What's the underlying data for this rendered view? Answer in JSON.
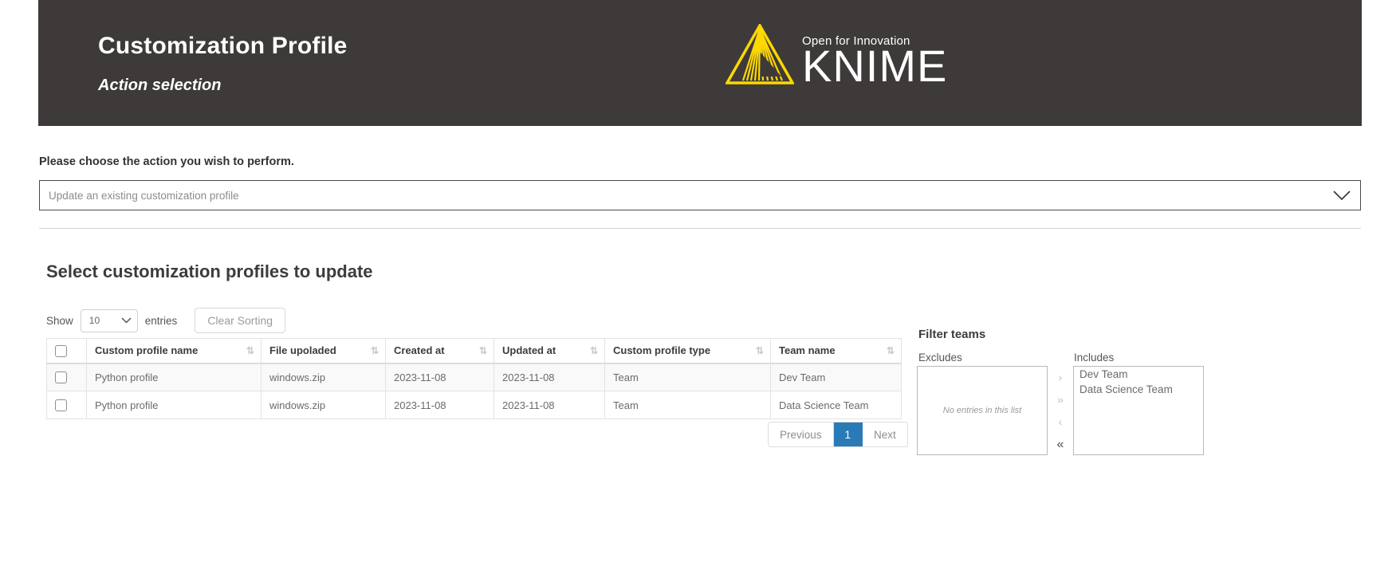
{
  "header": {
    "title": "Customization Profile",
    "subtitle": "Action selection",
    "logo_tagline": "Open for Innovation",
    "logo_word": "KNIME",
    "brand_yellow": "#FFD800",
    "banner_bg": "#3E3A39"
  },
  "action": {
    "label": "Please choose the action you wish to perform.",
    "selected": "Update an existing customization profile",
    "chevron_icon": "chevron-down-icon"
  },
  "table_section": {
    "title": "Select customization profiles to update",
    "show_label": "Show",
    "entries_label": "entries",
    "page_length": "10",
    "clear_sorting_label": "Clear Sorting",
    "columns": [
      "Custom profile name",
      "File upoladed",
      "Created at",
      "Updated at",
      "Custom profile type",
      "Team name"
    ],
    "rows": [
      {
        "name": "Python profile",
        "file": "windows.zip",
        "created": "2023-11-08",
        "updated": "2023-11-08",
        "type": "Team",
        "team": "Dev Team"
      },
      {
        "name": "Python profile",
        "file": "windows.zip",
        "created": "2023-11-08",
        "updated": "2023-11-08",
        "type": "Team",
        "team": "Data Science Team"
      }
    ],
    "pagination": {
      "previous": "Previous",
      "current_page": "1",
      "next": "Next",
      "active_color": "#2B7AB8"
    }
  },
  "filter": {
    "title": "Filter teams",
    "excludes_label": "Excludes",
    "includes_label": "Includes",
    "excludes_empty": "No entries in this list",
    "excludes": [],
    "includes": [
      "Dev Team",
      "Data Science Team"
    ],
    "buttons": {
      "move_right": "›",
      "move_all_right": "»",
      "move_left": "‹",
      "move_all_left": "«"
    }
  }
}
